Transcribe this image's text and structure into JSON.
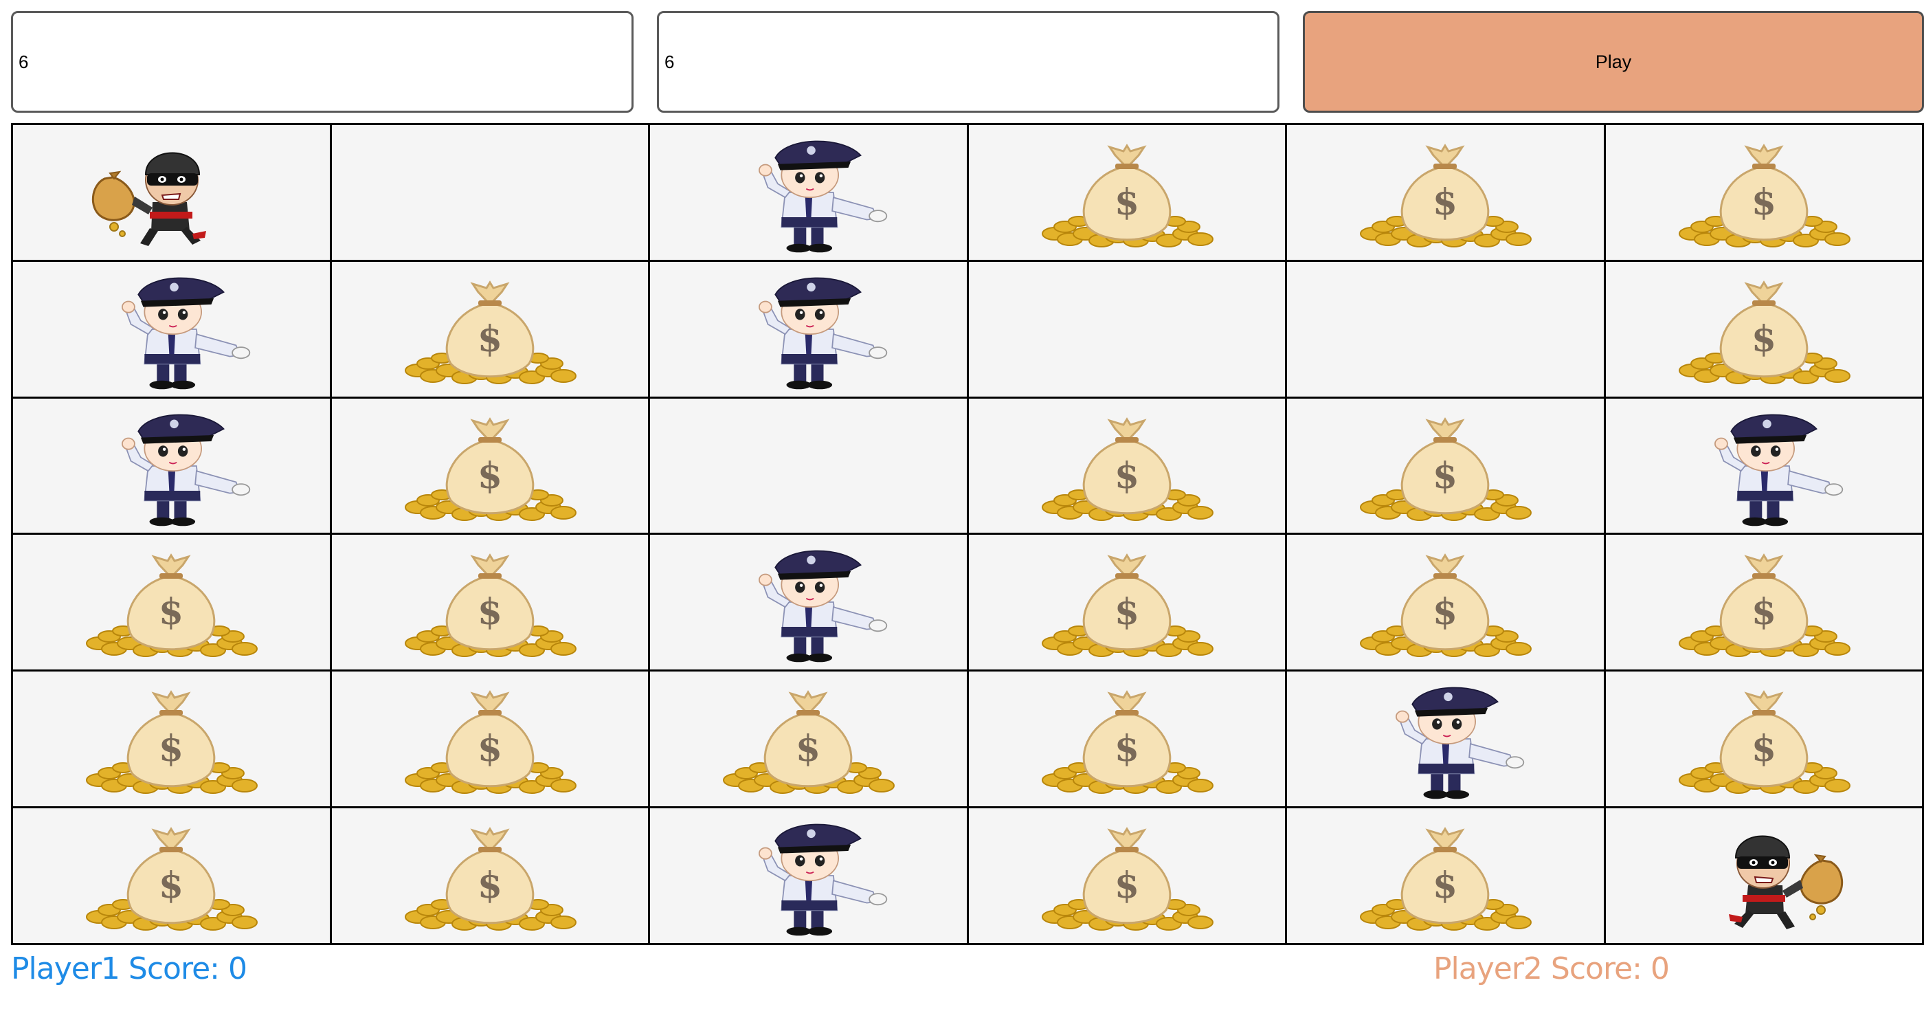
{
  "controls": {
    "rows_value": "6",
    "cols_value": "6",
    "play_label": "Play"
  },
  "board": {
    "rows": 6,
    "cols": 6,
    "cells": [
      [
        "thief",
        "empty",
        "police",
        "money",
        "money",
        "money"
      ],
      [
        "police",
        "money",
        "police",
        "empty",
        "empty",
        "money"
      ],
      [
        "police",
        "money",
        "empty",
        "money",
        "money",
        "police"
      ],
      [
        "money",
        "money",
        "police",
        "money",
        "money",
        "money"
      ],
      [
        "money",
        "money",
        "money",
        "money",
        "police",
        "money"
      ],
      [
        "money",
        "money",
        "police",
        "money",
        "money",
        "thief-flipped"
      ]
    ],
    "icon_names": {
      "thief": "thief-icon",
      "thief-flipped": "thief-icon",
      "police": "police-officer-icon",
      "money": "money-bag-icon",
      "empty": ""
    }
  },
  "scores": {
    "player1_label": "Player1 Score:",
    "player1_value": "0",
    "player2_label": "Player2 Score:",
    "player2_value": "0"
  },
  "colors": {
    "play_button": "#e8a37e",
    "player1": "#1e8be6",
    "player2": "#e8a37e",
    "cell_background": "#f5f5f5"
  }
}
